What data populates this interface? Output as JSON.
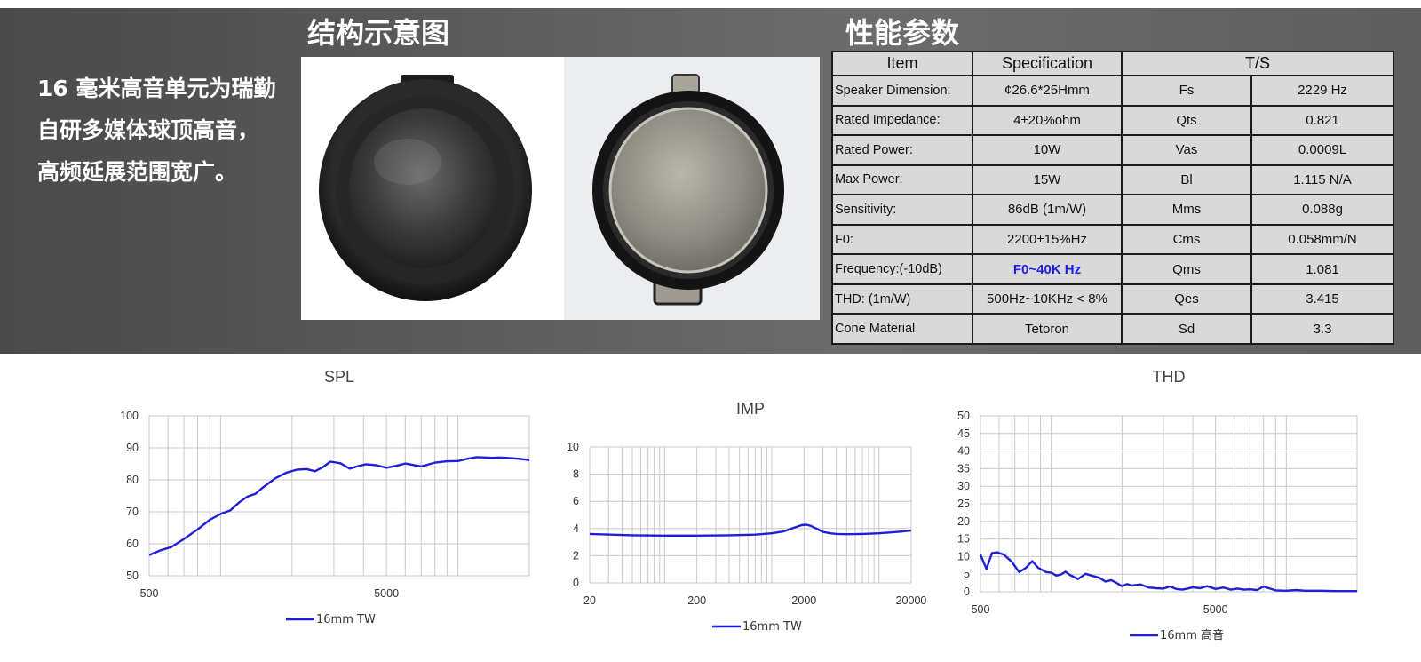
{
  "banner": {
    "intro_text": "16 毫米高音单元为瑞勤自研多媒体球顶高音，高频延展范围宽广。",
    "structure_title": "结构示意图",
    "spec_title": "性能参数"
  },
  "spec_table": {
    "headers": [
      "Item",
      "Specification",
      "T/S"
    ],
    "rows": [
      {
        "item": "Speaker Dimension:",
        "spec": "¢26.6*25Hmm",
        "ts": "Fs",
        "ts_value": "2229 Hz"
      },
      {
        "item": "Rated Impedance:",
        "spec": "4±20%ohm",
        "ts": "Qts",
        "ts_value": "0.821"
      },
      {
        "item": "Rated Power:",
        "spec": "10W",
        "ts": "Vas",
        "ts_value": "0.0009L"
      },
      {
        "item": "Max Power:",
        "spec": "15W",
        "ts": "Bl",
        "ts_value": "1.115 N/A"
      },
      {
        "item": "Sensitivity:",
        "spec": "86dB (1m/W)",
        "ts": "Mms",
        "ts_value": "0.088g"
      },
      {
        "item": "F0:",
        "spec": "2200±15%Hz",
        "ts": "Cms",
        "ts_value": "0.058mm/N"
      },
      {
        "item": "Frequency:(-10dB)",
        "spec": "F0~40K Hz",
        "ts": "Qms",
        "ts_value": "1.081"
      },
      {
        "item": "THD: (1m/W)",
        "spec": "500Hz~10KHz < 8%",
        "ts": "Qes",
        "ts_value": "3.415"
      },
      {
        "item": "Cone  Material",
        "spec": "Tetoron",
        "ts": "Sd",
        "ts_value": "3.3"
      }
    ],
    "highlight_color": "#1f20e6"
  },
  "chart_data": [
    {
      "type": "line",
      "title": "SPL",
      "x_scale": "log",
      "xlim": [
        500,
        20000
      ],
      "x_tick_labels": [
        "500",
        "5000"
      ],
      "ylim": [
        50,
        100
      ],
      "y_ticks": [
        50,
        60,
        70,
        80,
        90,
        100
      ],
      "grid": true,
      "legend_position": "bottom",
      "series": [
        {
          "name": "16mm TW",
          "color": "#1f1fd6",
          "x": [
            500,
            560,
            620,
            700,
            800,
            900,
            1000,
            1100,
            1200,
            1300,
            1400,
            1500,
            1700,
            1900,
            2100,
            2300,
            2500,
            2700,
            2900,
            3200,
            3500,
            3800,
            4100,
            4500,
            5000,
            5500,
            6000,
            7000,
            8000,
            9000,
            10000,
            11000,
            12000,
            13000,
            14000,
            15000,
            16000,
            18000,
            20000
          ],
          "y": [
            56.5,
            58,
            59,
            61.5,
            64.5,
            67.5,
            69.3,
            70.5,
            73,
            74.8,
            75.6,
            77.5,
            80.5,
            82.3,
            83.2,
            83.4,
            82.7,
            84,
            85.7,
            85.2,
            83.5,
            84.3,
            84.9,
            84.6,
            83.8,
            84.4,
            85.1,
            84.2,
            85.4,
            85.8,
            85.9,
            86.6,
            87.1,
            87.0,
            86.9,
            87.0,
            86.9,
            86.6,
            86.2
          ]
        }
      ]
    },
    {
      "type": "line",
      "title": "IMP",
      "x_scale": "log",
      "xlim": [
        20,
        20000
      ],
      "x_tick_labels": [
        "20",
        "200",
        "2000",
        "20000"
      ],
      "ylim": [
        0,
        10
      ],
      "y_ticks": [
        0,
        2,
        4,
        6,
        8,
        10
      ],
      "grid": true,
      "legend_position": "bottom",
      "series": [
        {
          "name": "16mm TW",
          "color": "#1f1fd6",
          "x": [
            20,
            50,
            100,
            200,
            400,
            700,
            1000,
            1300,
            1600,
            1900,
            2100,
            2300,
            2600,
            3000,
            3500,
            4000,
            5000,
            7000,
            10000,
            15000,
            20000
          ],
          "y": [
            3.6,
            3.5,
            3.48,
            3.48,
            3.5,
            3.55,
            3.65,
            3.8,
            4.05,
            4.25,
            4.28,
            4.2,
            4.0,
            3.75,
            3.65,
            3.6,
            3.58,
            3.6,
            3.65,
            3.75,
            3.85
          ]
        }
      ]
    },
    {
      "type": "line",
      "title": "THD",
      "x_scale": "log",
      "xlim": [
        500,
        20000
      ],
      "x_tick_labels": [
        "500",
        "5000"
      ],
      "ylim": [
        0,
        50
      ],
      "y_ticks": [
        0,
        5,
        10,
        15,
        20,
        25,
        30,
        35,
        40,
        45,
        50
      ],
      "grid": true,
      "legend_position": "bottom",
      "series": [
        {
          "name": "16mm 高音",
          "color": "#1f1fd6",
          "x": [
            500,
            530,
            560,
            590,
            630,
            680,
            730,
            780,
            830,
            880,
            950,
            1000,
            1050,
            1100,
            1150,
            1200,
            1300,
            1400,
            1500,
            1600,
            1700,
            1800,
            1900,
            2000,
            2100,
            2200,
            2400,
            2600,
            2800,
            3000,
            3200,
            3400,
            3600,
            3800,
            4000,
            4300,
            4600,
            5000,
            5400,
            5800,
            6200,
            6600,
            7000,
            7500,
            8000,
            9000,
            10000,
            11000,
            12000,
            14000,
            16000,
            18000,
            20000
          ],
          "y": [
            10.5,
            6.5,
            11,
            11.2,
            10.5,
            8.5,
            5.6,
            6.8,
            8.7,
            6.8,
            5.6,
            5.4,
            4.6,
            4.9,
            5.7,
            4.8,
            3.6,
            5.1,
            4.5,
            4.0,
            2.9,
            3.3,
            2.5,
            1.6,
            2.2,
            1.8,
            2.1,
            1.2,
            1.0,
            0.9,
            1.5,
            0.8,
            0.6,
            0.9,
            1.3,
            1.0,
            1.6,
            0.8,
            1.2,
            0.6,
            0.9,
            0.6,
            0.7,
            0.5,
            1.5,
            0.4,
            0.3,
            0.5,
            0.3,
            0.3,
            0.2,
            0.2,
            0.2
          ]
        }
      ]
    }
  ]
}
